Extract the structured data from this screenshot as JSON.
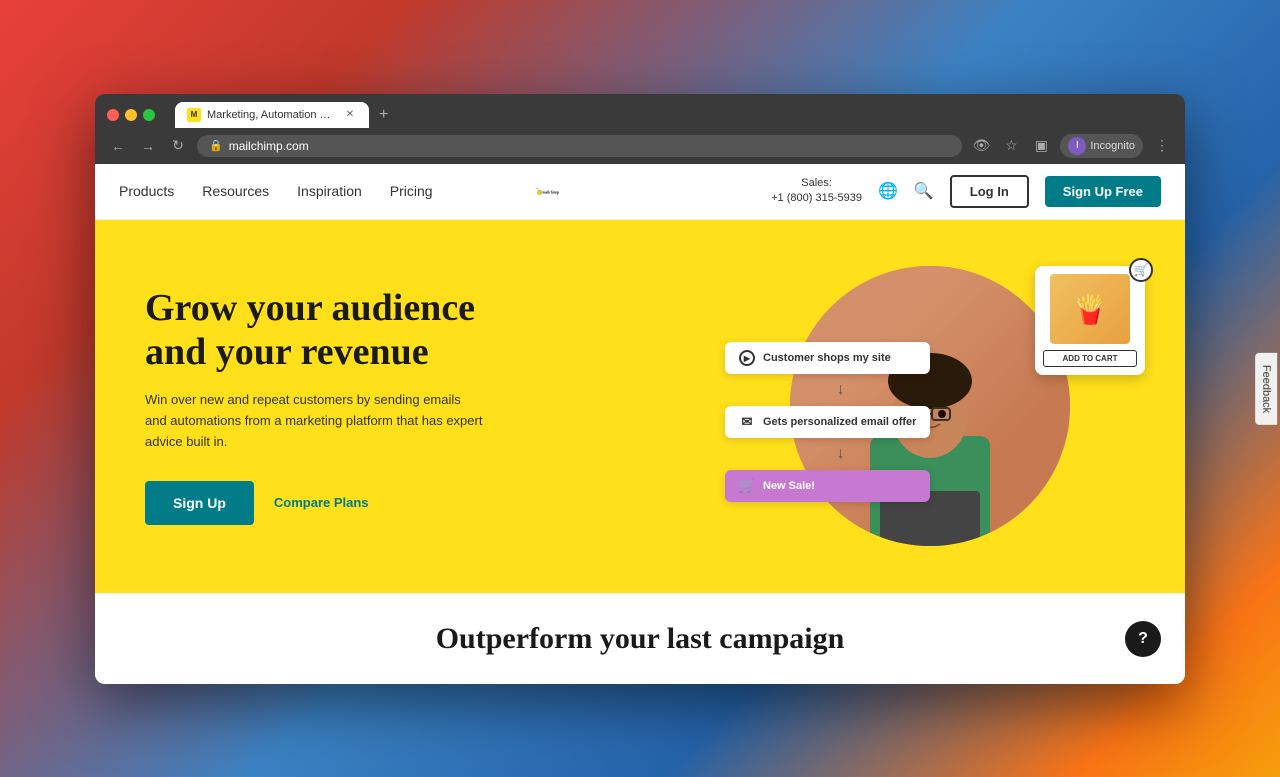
{
  "browser": {
    "tab_title": "Marketing, Automation & Emai...",
    "url": "mailchimp.com",
    "new_tab_label": "+",
    "profile_label": "Incognito",
    "tab_favicon": "M"
  },
  "nav": {
    "links": [
      {
        "label": "Products",
        "id": "products"
      },
      {
        "label": "Resources",
        "id": "resources"
      },
      {
        "label": "Inspiration",
        "id": "inspiration"
      },
      {
        "label": "Pricing",
        "id": "pricing"
      }
    ],
    "logo_text": "mailchimp",
    "sales_line1": "Sales:",
    "sales_line2": "+1 (800) 315-5939",
    "login_label": "Log In",
    "signup_label": "Sign Up Free"
  },
  "hero": {
    "title": "Grow your audience and your revenue",
    "subtitle": "Win over new and repeat customers by sending emails and automations from a marketing platform that has expert advice built in.",
    "signup_label": "Sign Up",
    "compare_label": "Compare Plans",
    "flow": {
      "step1": "Customer shops my site",
      "step2": "Gets personalized email offer",
      "step3": "New Sale!"
    },
    "product_card": {
      "add_to_cart": "ADD TO CART"
    }
  },
  "outperform": {
    "title": "Outperform your last campaign",
    "help_label": "?"
  },
  "feedback": {
    "label": "Feedback"
  },
  "colors": {
    "hero_bg": "#ffe01b",
    "teal": "#007c89",
    "pink": "#ff6b9d",
    "purple": "#c778d0"
  }
}
